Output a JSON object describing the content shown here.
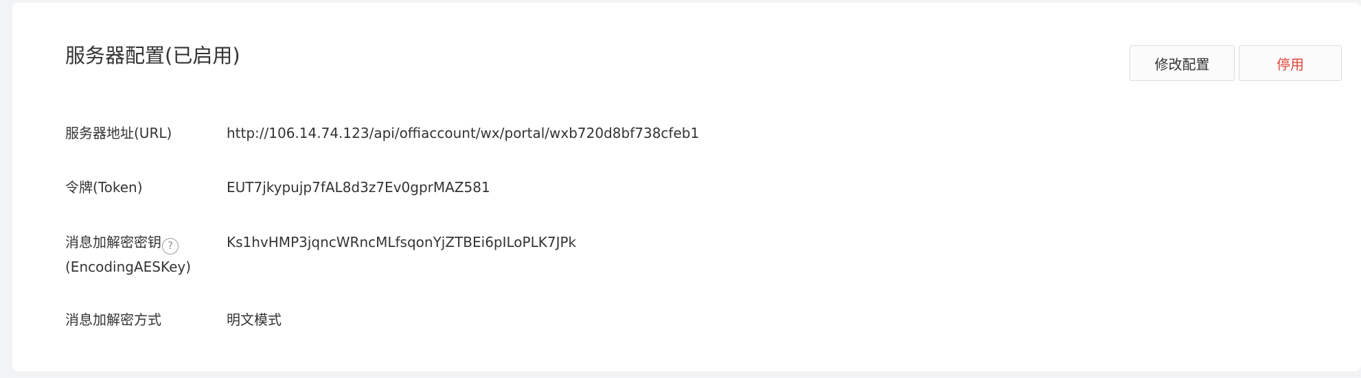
{
  "header": {
    "title": "服务器配置(已启用)",
    "edit_label": "修改配置",
    "disable_label": "停用"
  },
  "fields": {
    "url": {
      "label": "服务器地址(URL)",
      "value": "http://106.14.74.123/api/offiaccount/wx/portal/wxb720d8bf738cfeb1"
    },
    "token": {
      "label": "令牌(Token)",
      "value": "EUT7jkypujp7fAL8d3z7Ev0gprMAZ581"
    },
    "aes_key": {
      "label_line1": "消息加解密密钥",
      "label_line2": "(EncodingAESKey)",
      "help_glyph": "?",
      "value": "Ks1hvHMP3jqncWRncMLfsqonYjZTBEi6pILoPLK7JPk"
    },
    "mode": {
      "label": "消息加解密方式",
      "value": "明文模式"
    }
  },
  "colors": {
    "danger": "#e0463b",
    "text": "#333333",
    "background": "#f2f3f5"
  },
  "icons": {
    "help": "question-circle-icon"
  }
}
